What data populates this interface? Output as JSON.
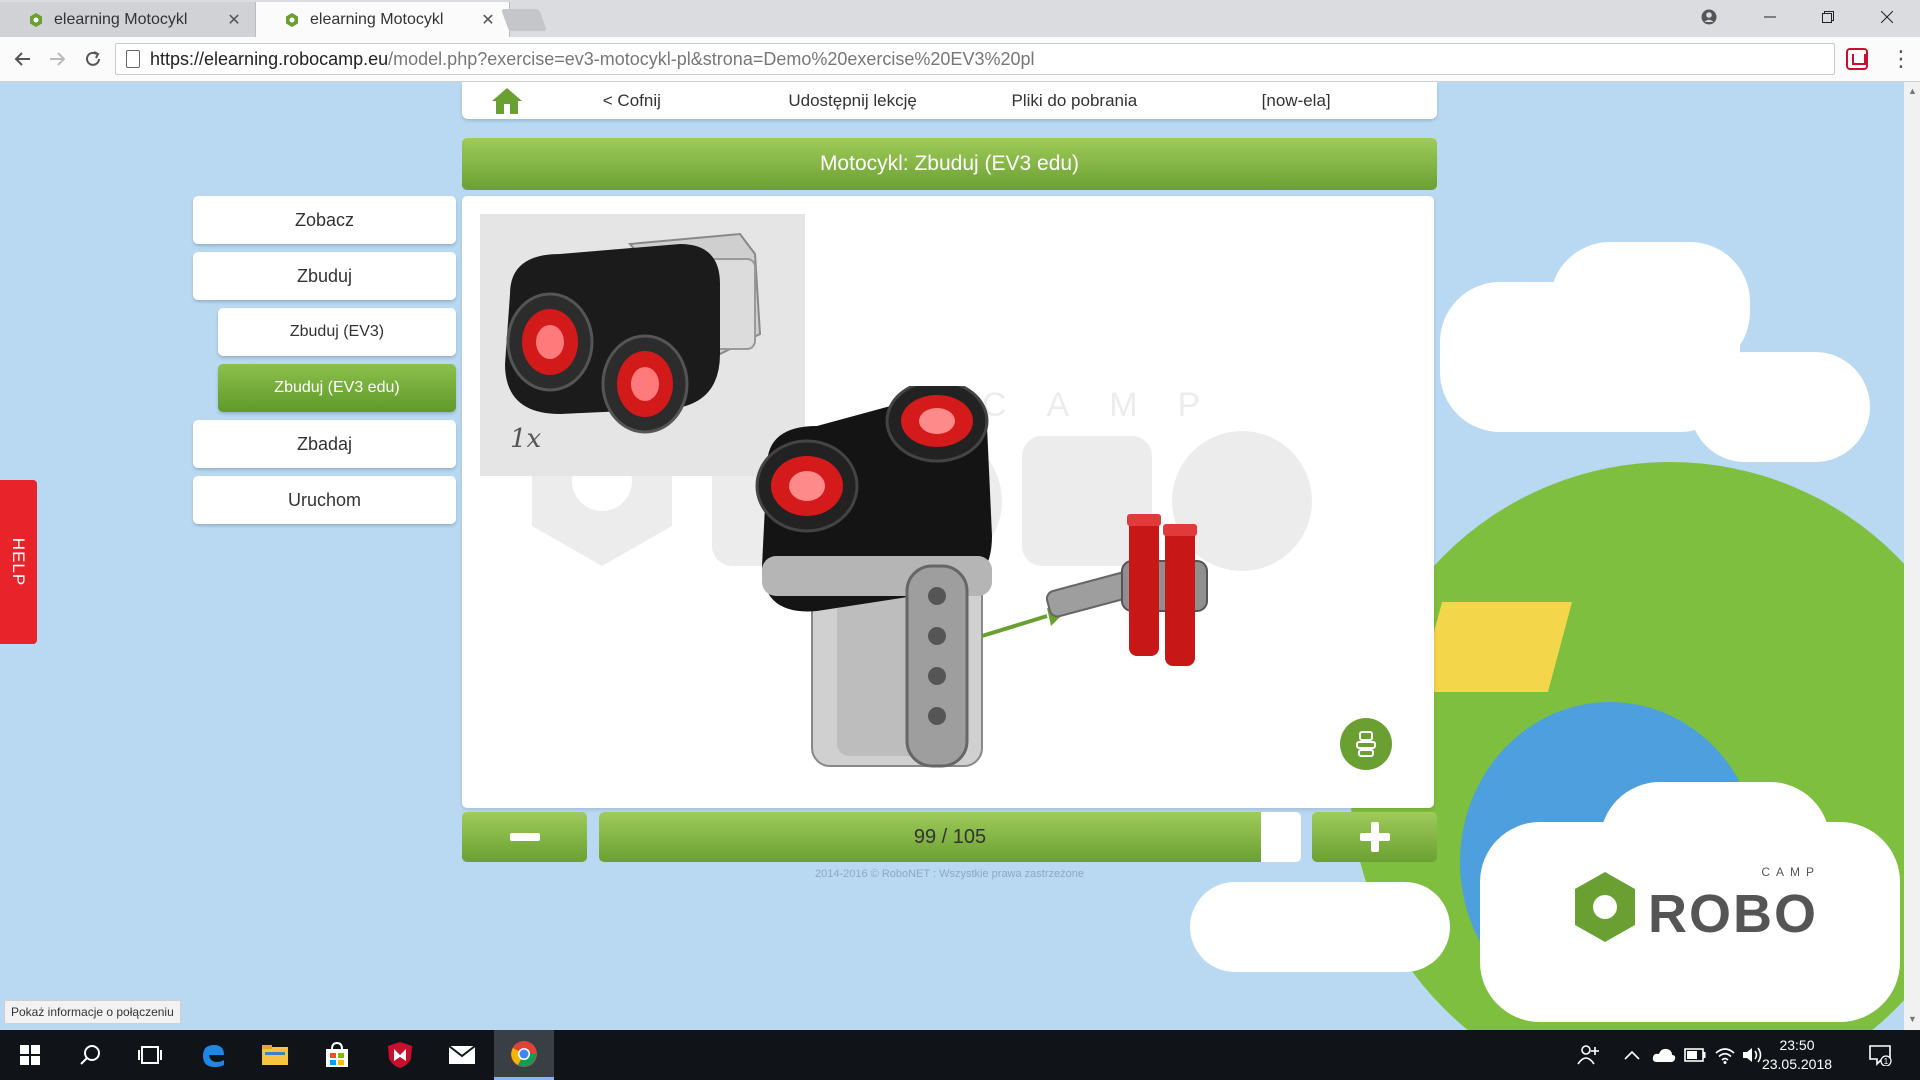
{
  "browser": {
    "tabs": [
      {
        "title": "elearning Motocykl",
        "active": false
      },
      {
        "title": "elearning Motocykl",
        "active": true
      }
    ],
    "url_host": "https://elearning.robocamp.eu",
    "url_path": "/model.php?exercise=ev3-motocykl-pl&strona=Demo%20exercise%20EV3%20pl"
  },
  "topnav": {
    "back": "< Cofnij",
    "share": "Udostępnij lekcję",
    "downloads": "Pliki do pobrania",
    "user": "[now-ela]"
  },
  "lesson_title": "Motocykl: Zbuduj (EV3 edu)",
  "side_menu": {
    "items": [
      {
        "label": "Zobacz"
      },
      {
        "label": "Zbuduj"
      },
      {
        "label": "Zbuduj (EV3)"
      },
      {
        "label": "Zbuduj (EV3 edu)"
      },
      {
        "label": "Zbadaj"
      },
      {
        "label": "Uruchom"
      }
    ]
  },
  "parts": {
    "count": "1x"
  },
  "pager": {
    "current": 99,
    "total": 105,
    "label": "99 / 105",
    "progress_fraction": 0.943
  },
  "footer": "2014-2016 © RoboNET : Wszystkie prawa zastrzeżone",
  "help_label": "HELP",
  "watermark_text": "CAMP",
  "logo": {
    "camp": "CAMP",
    "robo": "ROBO"
  },
  "status_tooltip": "Pokaż informacje o połączeniu",
  "taskbar": {
    "time": "23:50",
    "date": "23.05.2018"
  },
  "colors": {
    "accent_green": "#6aa032",
    "help_red": "#e8232a",
    "sky": "#b9d9f3"
  }
}
